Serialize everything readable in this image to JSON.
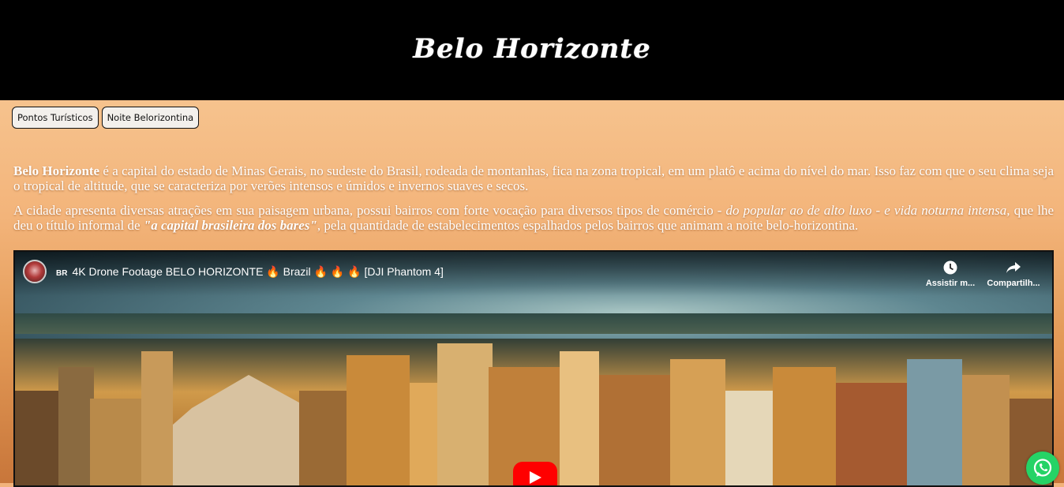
{
  "header": {
    "title": "Belo Horizonte"
  },
  "nav": {
    "items": [
      {
        "label": "Pontos Turísticos"
      },
      {
        "label": "Noite Belorizontina"
      }
    ]
  },
  "intro": {
    "p1_bold": "Belo Horizonte",
    "p1_rest": " é a capital do estado de Minas Gerais, no sudeste do Brasil, rodeada de montanhas, fica na zona tropical, em um platô e acima do nível do mar. Isso faz com que o seu clima seja o tropical de altitude, que se caracteriza por verões intensos e úmidos e invernos suaves e secos.",
    "p2_start": "A cidade apresenta diversas atrações em sua paisagem urbana, possui bairros com forte vocação para diversos tipos de comércio",
    "p2_italic": " - do popular ao de alto luxo - e vida noturna intensa,",
    "p2_mid": " que lhe deu o título informal de ",
    "p2_bold_italic": "\"a capital brasileira dos bares\"",
    "p2_end": ", pela quantidade de estabelecimentos espalhados pelos bairros que animam a noite belo-horizontina."
  },
  "video": {
    "flag": "BR",
    "title": "4K Drone Footage BELO HORIZONTE 🔥 Brazil 🔥 🔥 🔥 [DJI Phantom 4]",
    "watch_later": "Assistir m...",
    "share": "Compartilh..."
  },
  "icons": {
    "watch_later": "clock-icon",
    "share": "share-icon",
    "play": "play-icon",
    "whatsapp": "whatsapp-icon"
  },
  "colors": {
    "header_bg": "#000000",
    "yt_red": "#ff0000",
    "whatsapp_green": "#25d366"
  }
}
